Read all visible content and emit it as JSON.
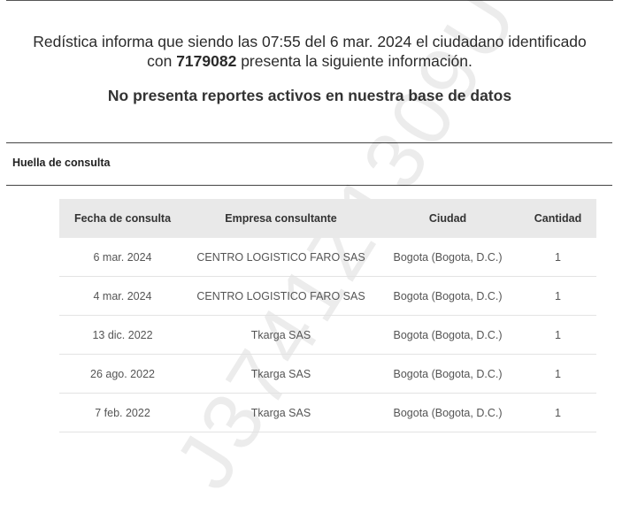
{
  "intro": {
    "line1": "Redística informa que siendo las 07:55 del 6 mar. 2024 el ciudadano identificado",
    "line2_prefix": "con ",
    "document_id": "7179082",
    "line2_suffix": " presenta la siguiente información."
  },
  "status_message": "No presenta reportes activos en nuestra base de datos",
  "section_title": "Huella de consulta",
  "watermark": "J3741Z1309U",
  "table": {
    "headers": {
      "fecha": "Fecha de consulta",
      "empresa": "Empresa consultante",
      "ciudad": "Ciudad",
      "cantidad": "Cantidad"
    },
    "rows": [
      {
        "fecha": "6 mar. 2024",
        "empresa": "CENTRO LOGISTICO FARO SAS",
        "ciudad": "Bogota (Bogota, D.C.)",
        "cantidad": "1"
      },
      {
        "fecha": "4 mar. 2024",
        "empresa": "CENTRO LOGISTICO FARO SAS",
        "ciudad": "Bogota (Bogota, D.C.)",
        "cantidad": "1"
      },
      {
        "fecha": "13 dic. 2022",
        "empresa": "Tkarga SAS",
        "ciudad": "Bogota (Bogota, D.C.)",
        "cantidad": "1"
      },
      {
        "fecha": "26 ago. 2022",
        "empresa": "Tkarga SAS",
        "ciudad": "Bogota (Bogota, D.C.)",
        "cantidad": "1"
      },
      {
        "fecha": "7 feb. 2022",
        "empresa": "Tkarga SAS",
        "ciudad": "Bogota (Bogota, D.C.)",
        "cantidad": "1"
      }
    ]
  }
}
